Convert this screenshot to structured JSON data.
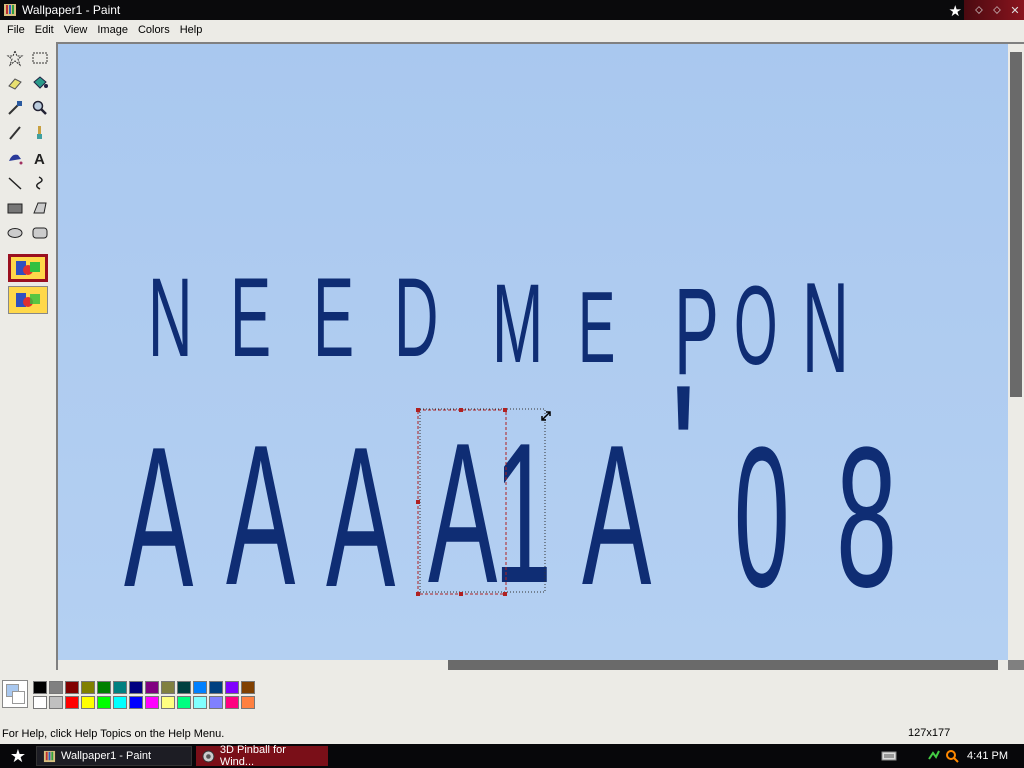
{
  "window": {
    "title": "Wallpaper1 - Paint",
    "controls": [
      "minimize",
      "restore",
      "close"
    ]
  },
  "menu": [
    "File",
    "Edit",
    "View",
    "Image",
    "Colors",
    "Help"
  ],
  "tools": [
    {
      "name": "free-form-select",
      "icon": "lasso-star-icon"
    },
    {
      "name": "select",
      "icon": "dashed-rect-icon"
    },
    {
      "name": "eraser",
      "icon": "eraser-icon"
    },
    {
      "name": "fill-with-color",
      "icon": "paint-bucket-icon"
    },
    {
      "name": "pick-color",
      "icon": "eyedropper-icon"
    },
    {
      "name": "magnifier",
      "icon": "magnifier-icon"
    },
    {
      "name": "pencil",
      "icon": "pencil-icon"
    },
    {
      "name": "brush",
      "icon": "brush-icon"
    },
    {
      "name": "airbrush",
      "icon": "airbrush-icon"
    },
    {
      "name": "text",
      "icon": "text-a-icon"
    },
    {
      "name": "line",
      "icon": "line-icon"
    },
    {
      "name": "curve",
      "icon": "curve-icon"
    },
    {
      "name": "rectangle",
      "icon": "rectangle-icon"
    },
    {
      "name": "polygon",
      "icon": "polygon-icon"
    },
    {
      "name": "ellipse",
      "icon": "ellipse-icon"
    },
    {
      "name": "rounded-rectangle",
      "icon": "rounded-rect-icon"
    }
  ],
  "tool_options": [
    {
      "name": "opaque-selection",
      "selected": true
    },
    {
      "name": "transparent-selection",
      "selected": false
    }
  ],
  "canvas": {
    "line1": [
      "N",
      "E",
      "E",
      "D",
      "M",
      "E",
      "P",
      "O",
      "N"
    ],
    "line2": [
      "A",
      "A",
      "A",
      "A",
      "1",
      "A",
      "'",
      "0",
      "8"
    ],
    "text_color": "#0f2d74",
    "bg_color": "#aecbf0"
  },
  "palette": {
    "foreground": "#a9c8ef",
    "background": "#ffffff",
    "row1": [
      "#000000",
      "#808080",
      "#800000",
      "#808000",
      "#008000",
      "#008080",
      "#000080",
      "#800080",
      "#808040",
      "#004040",
      "#0080ff",
      "#004080",
      "#8000ff",
      "#804000"
    ],
    "row2": [
      "#ffffff",
      "#c0c0c0",
      "#ff0000",
      "#ffff00",
      "#00ff00",
      "#00ffff",
      "#0000ff",
      "#ff00ff",
      "#ffff80",
      "#00ff80",
      "#80ffff",
      "#8080ff",
      "#ff0080",
      "#ff8040"
    ]
  },
  "status": {
    "help_text": "For Help, click Help Topics on the Help Menu.",
    "selection_size": "127x177"
  },
  "taskbar": {
    "tasks": [
      {
        "label": "Wallpaper1 - Paint",
        "active": true
      },
      {
        "label": "3D Pinball for Wind...",
        "active": false
      }
    ],
    "clock": "4:41 PM"
  }
}
